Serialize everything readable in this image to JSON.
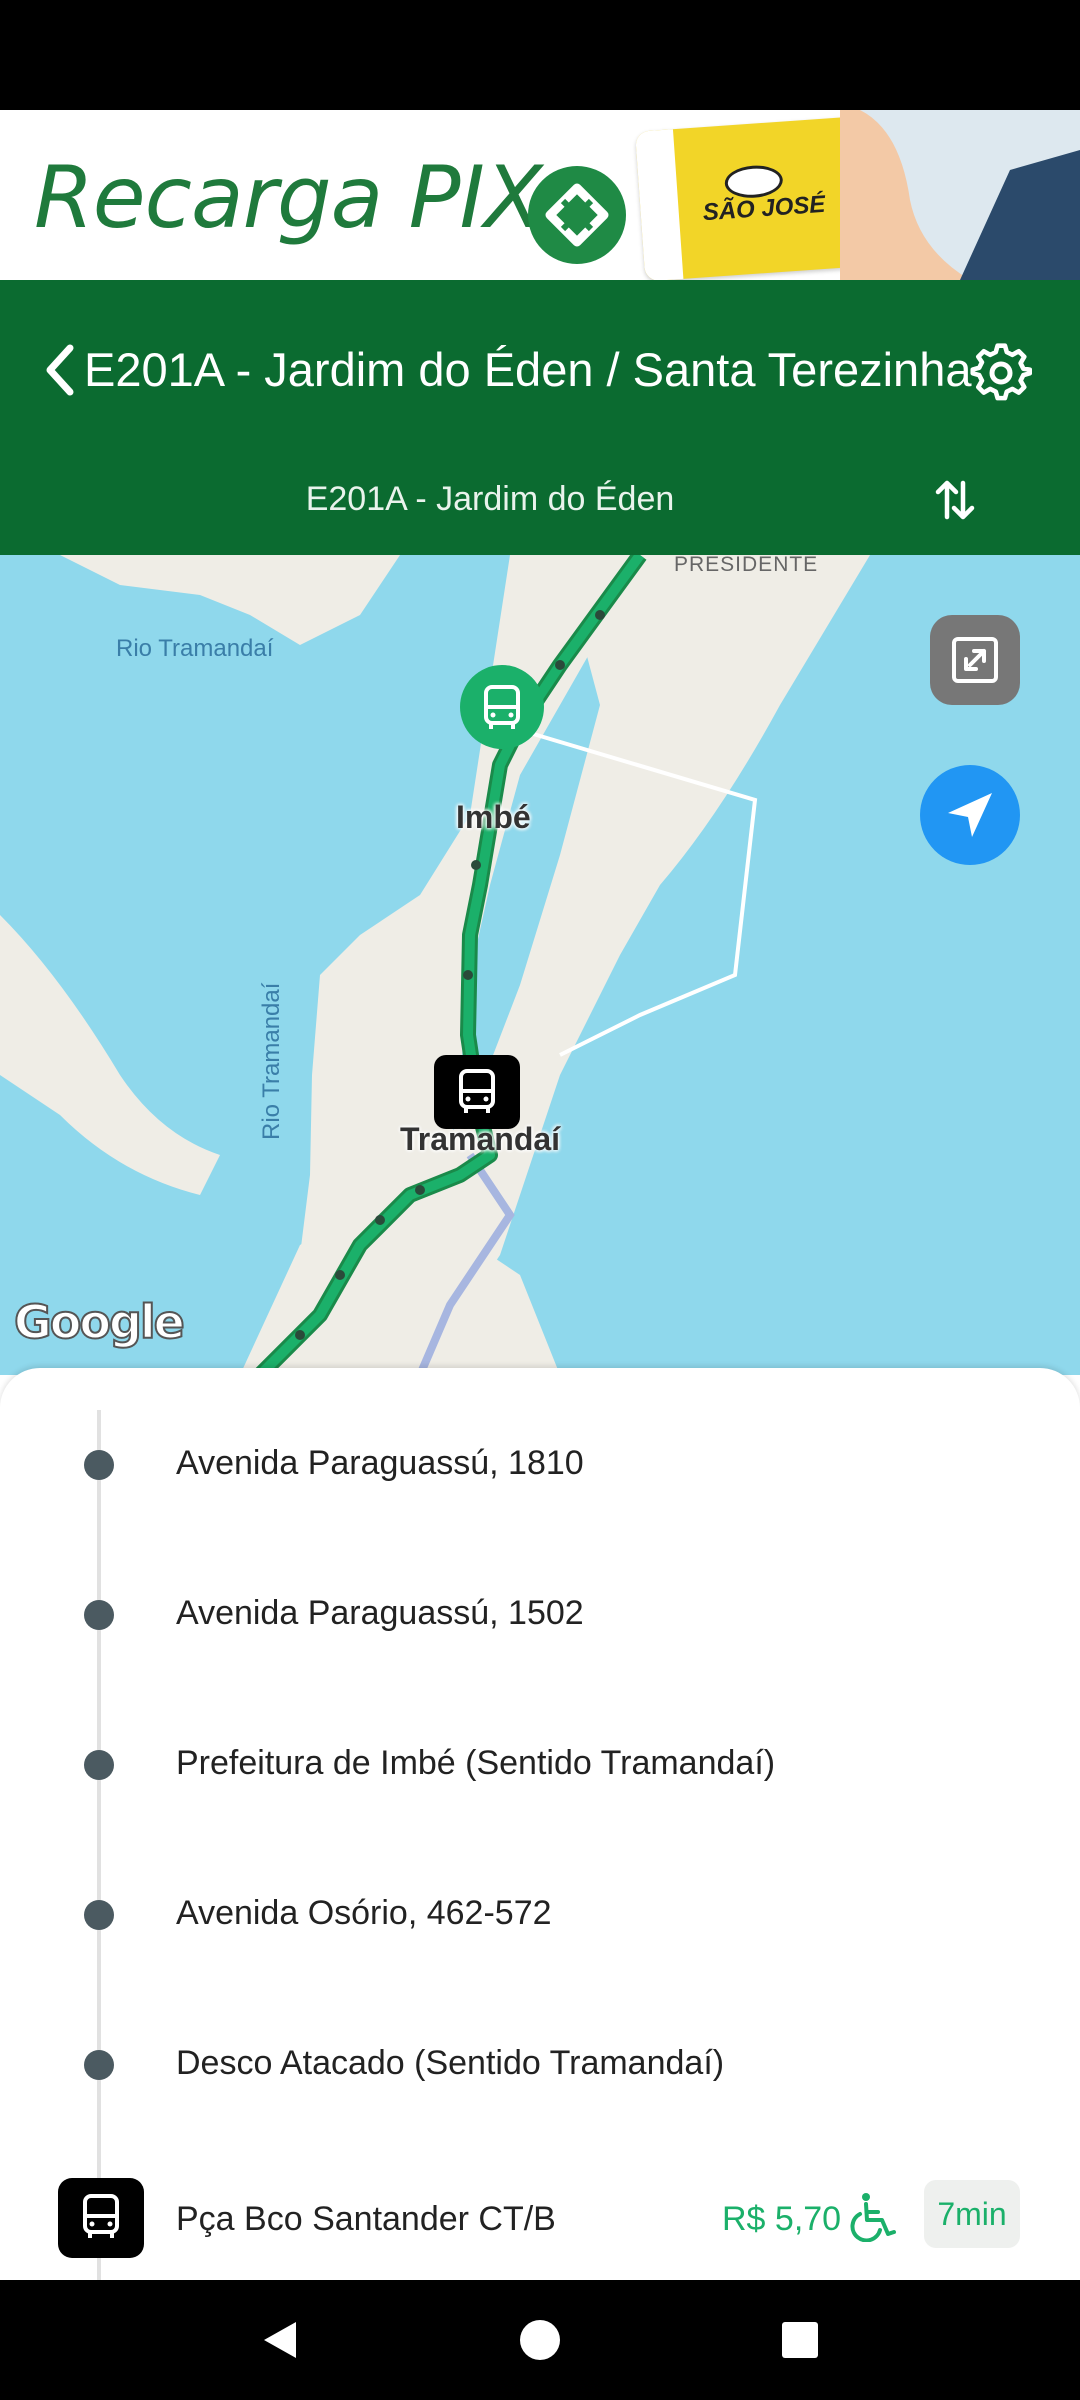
{
  "banner": {
    "title": "Recarga PIX",
    "card_brand": "SÃO JOSÉ"
  },
  "header": {
    "route_title": "E201A - Jardim do Éden / Santa Terezinha",
    "direction": "E201A - Jardim do Éden"
  },
  "map": {
    "labels": {
      "river_1": "Rio Tramandaí",
      "river_2": "Rio Tramandaí",
      "presidente": "PRESIDENTE",
      "imbe": "Imbé",
      "tramandai": "Tramandaí"
    },
    "attribution": "Google",
    "colors": {
      "water": "#8fd8ec",
      "land": "#efede6",
      "route": "#1bb06a",
      "bus_stop": "#1bb06a"
    }
  },
  "stops": [
    {
      "name": "Avenida Paraguassú, 1810"
    },
    {
      "name": "Avenida Paraguassú, 1502"
    },
    {
      "name": "Prefeitura de Imbé (Sentido Tramandaí)"
    },
    {
      "name": "Avenida Osório, 462-572"
    },
    {
      "name": "Desco Atacado (Sentido Tramandaí)"
    }
  ],
  "current_stop": {
    "name": "Pça Bco Santander CT/B",
    "price": "R$ 5,70",
    "time": "7min"
  },
  "icons": [
    "back-chevron-icon",
    "gear-icon",
    "swap-vertical-icon",
    "bus-icon",
    "expand-icon",
    "navigation-arrow-icon",
    "wheelchair-icon",
    "nav-back-icon",
    "nav-home-icon",
    "nav-recents-icon"
  ]
}
